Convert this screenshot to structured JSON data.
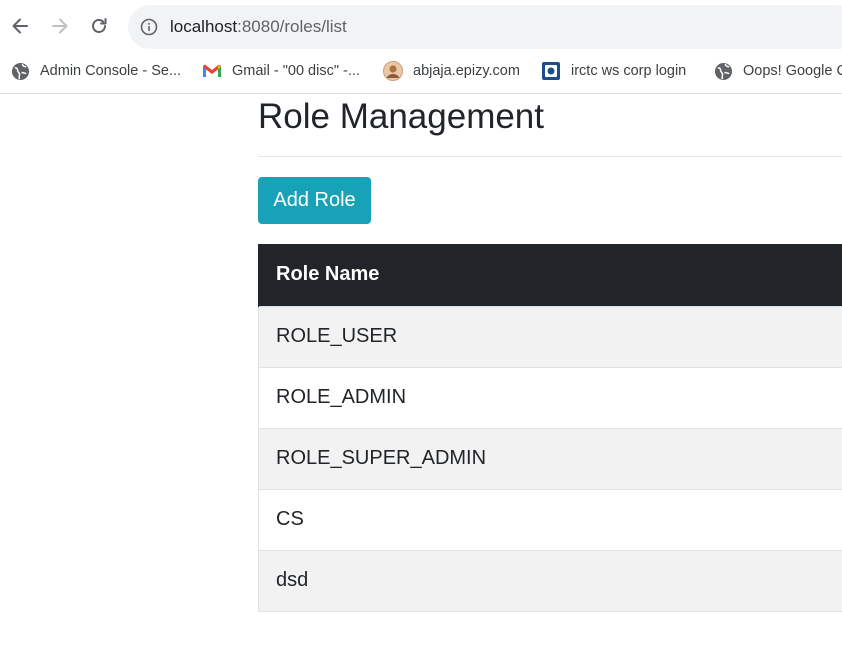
{
  "browser": {
    "url_host": "localhost",
    "url_rest": ":8080/roles/list",
    "bookmarks": [
      {
        "label": "Admin Console - Se...",
        "icon": "globe-icon"
      },
      {
        "label": "Gmail - \"00 disc\" -...",
        "icon": "gmail-icon"
      },
      {
        "label": "abjaja.epizy.com",
        "icon": "avatar-icon"
      },
      {
        "label": "irctc ws corp login",
        "icon": "irctc-icon"
      },
      {
        "label": "Oops! Google C",
        "icon": "globe-icon"
      }
    ]
  },
  "page": {
    "title": "Role Management",
    "add_button_label": "Add Role"
  },
  "table": {
    "headers": [
      "Role Name"
    ],
    "rows": [
      "ROLE_USER",
      "ROLE_ADMIN",
      "ROLE_SUPER_ADMIN",
      "CS",
      "dsd"
    ]
  },
  "colors": {
    "add_button": "#17a2b8",
    "table_header": "#212529",
    "striped_row": "#f2f2f2"
  }
}
